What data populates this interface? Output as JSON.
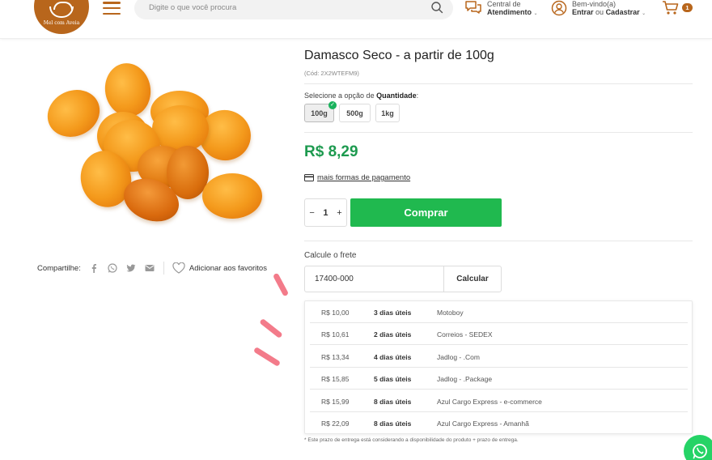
{
  "header": {
    "logo_text": "Mel com Aveia",
    "search_placeholder": "Digite o que você procura",
    "support_line1": "Central de",
    "support_line2": "Atendimento",
    "account_line1": "Bem-vindo(a)",
    "account_enter": "Entrar",
    "account_or": "ou",
    "account_register": "Cadastrar",
    "cart_count": "1",
    "brand_color": "#b8661c"
  },
  "product": {
    "title": "Damasco Seco - a partir de 100g",
    "code": "(Cód: 2X2WTEFM9)",
    "option_prefix": "Selecione a opção de",
    "option_name": "Quantidade",
    "option_suffix": ":",
    "options": [
      "100g",
      "500g",
      "1kg"
    ],
    "selected_option": "100g",
    "price": "R$ 8,29",
    "price_color": "#1d9a4f",
    "payment_link": "mais formas de pagamento",
    "quantity": "1",
    "minus": "−",
    "plus": "+",
    "buy_label": "Comprar",
    "buy_color": "#20b94f"
  },
  "share": {
    "label": "Compartilhe:",
    "icons": [
      "facebook-icon",
      "whatsapp-icon",
      "twitter-icon",
      "email-icon"
    ],
    "favorite_label": "Adicionar aos favoritos"
  },
  "shipping": {
    "label": "Calcule o frete",
    "cep_value": "17400-000",
    "calc_label": "Calcular",
    "rows": [
      {
        "price": "R$ 10,00",
        "days": "3 dias úteis",
        "carrier": "Motoboy"
      },
      {
        "price": "R$ 10,61",
        "days": "2 dias úteis",
        "carrier": "Correios - SEDEX"
      },
      {
        "price": "R$ 13,34",
        "days": "4 dias úteis",
        "carrier": "Jadlog - .Com"
      },
      {
        "price": "R$ 15,85",
        "days": "5 dias úteis",
        "carrier": "Jadlog - .Package"
      },
      {
        "price": "R$ 15,99",
        "days": "8 dias úteis",
        "carrier": "Azul Cargo Express - e-commerce"
      },
      {
        "price": "R$ 22,09",
        "days": "8 dias úteis",
        "carrier": "Azul Cargo Express - Amanhã"
      }
    ],
    "footnote": "* Este prazo de entrega está considerando a disponibilidade do produto + prazo de entrega."
  }
}
